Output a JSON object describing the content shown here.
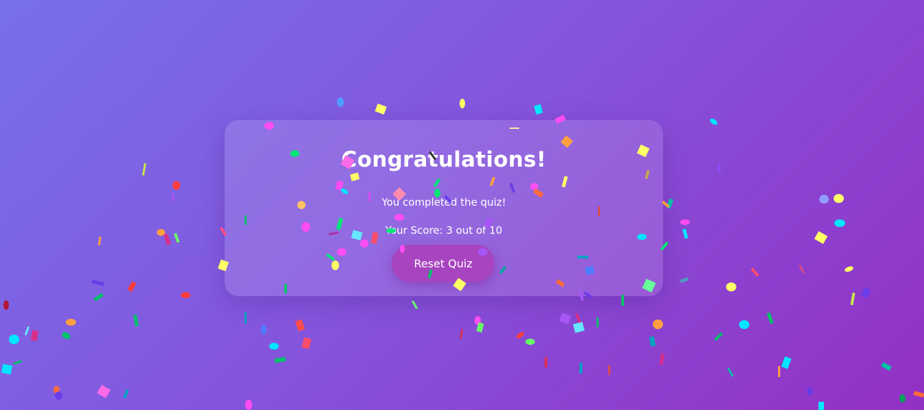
{
  "result": {
    "title": "Congratulations!",
    "message": "You completed the quiz!",
    "score_text": "Your Score: 3 out of 10",
    "reset_label": "Reset Quiz"
  },
  "theme": {
    "background_start": "#7770ea",
    "background_end": "#9330c4",
    "button_color": "#a844bf",
    "text_color": "#ffffff"
  },
  "confetti_colors": [
    "#ff4df2",
    "#ffff66",
    "#00e6ff",
    "#00e676",
    "#ff3d3d",
    "#ff9f40",
    "#4d7dff",
    "#a855f7"
  ]
}
